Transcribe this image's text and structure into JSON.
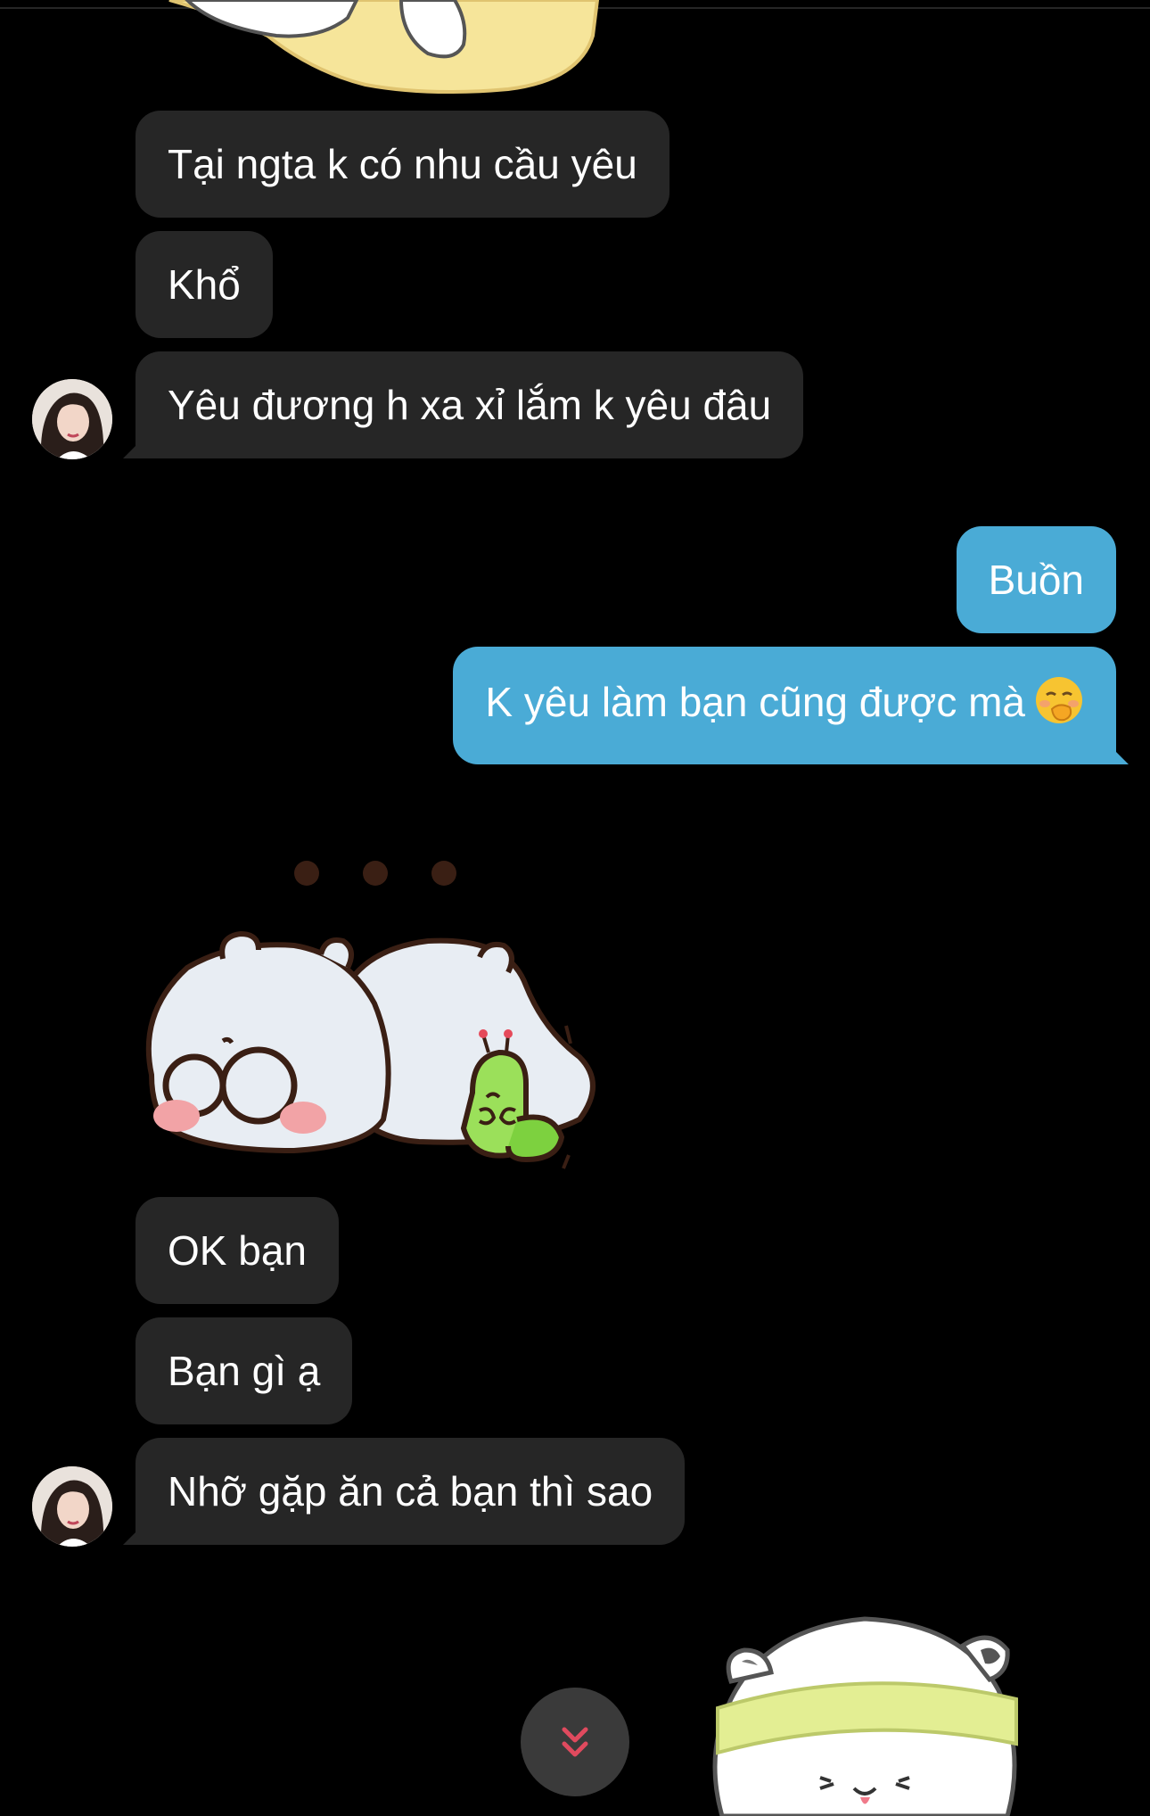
{
  "messages": [
    {
      "side": "in",
      "text": "Tại ngta k có nhu cầu yêu"
    },
    {
      "side": "in",
      "text": "Khổ"
    },
    {
      "side": "in",
      "text": "Yêu đương h xa xỉ lắm k yêu đâu"
    },
    {
      "side": "out",
      "text": "Buồn"
    },
    {
      "side": "out",
      "text": "K yêu làm bạn cũng được mà"
    },
    {
      "side": "in",
      "text": "OK bạn"
    },
    {
      "side": "in",
      "text": "Bạn gì ạ"
    },
    {
      "side": "in",
      "text": "Nhỡ gặp ăn cả bạn thì sao"
    }
  ],
  "stickers": [
    {
      "name": "yellow-pillow-sticker"
    },
    {
      "name": "sleeping-bear-with-caterpillar-sticker"
    },
    {
      "name": "hamster-headband-sticker"
    }
  ],
  "icons": {
    "scroll_down": "double-chevron-down-icon",
    "emoji": "face-with-hand-over-mouth-emoji"
  },
  "colors": {
    "background": "#000000",
    "incoming_bubble": "#262626",
    "outgoing_bubble": "#4aabd6",
    "scroll_chevron": "#e04a5e"
  }
}
